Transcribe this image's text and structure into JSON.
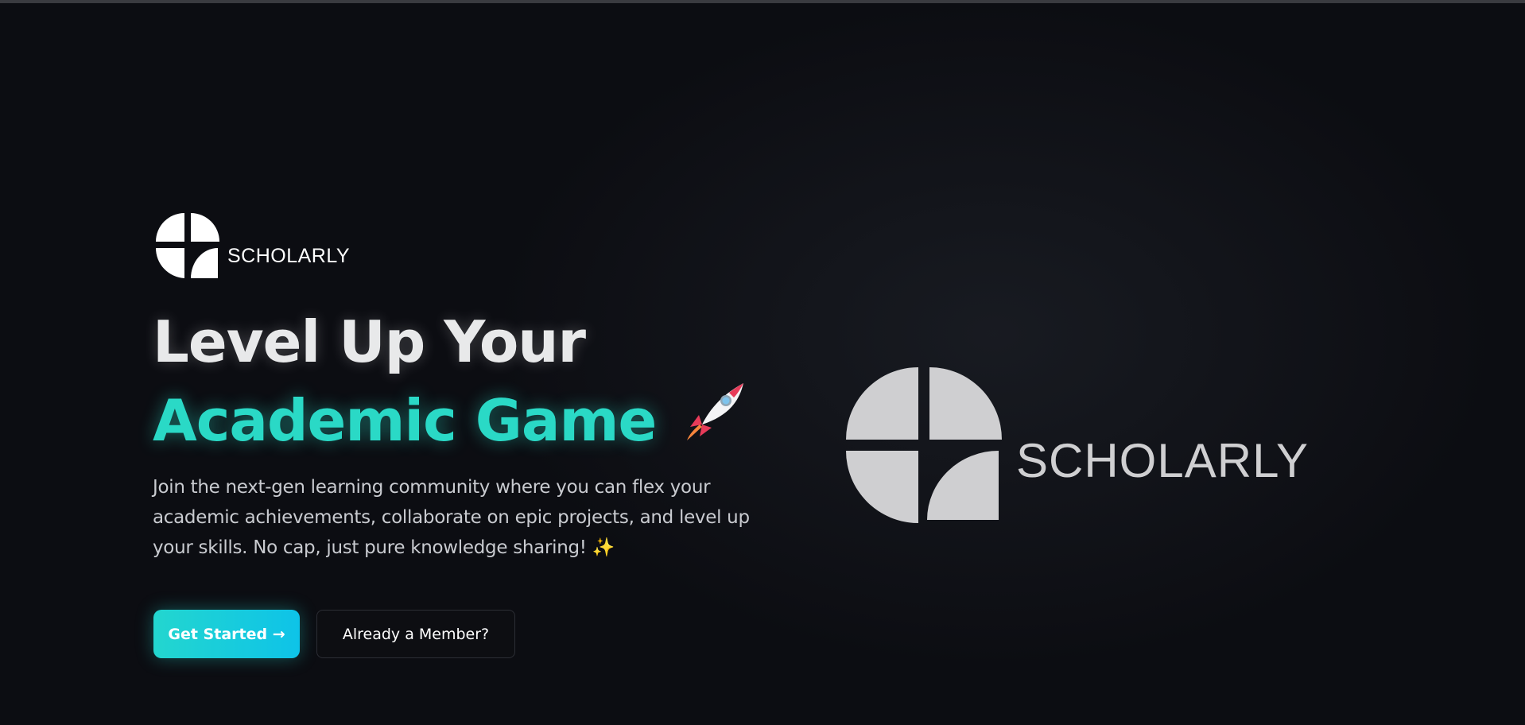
{
  "brand": {
    "name": "SCHOLARLY",
    "logo_icon": "scholarly-logo-icon",
    "logo_color_small": "#ffffff",
    "logo_color_large": "#cfcfd1"
  },
  "hero": {
    "headline_line1": "Level Up Your",
    "headline_line2": "Academic Game",
    "headline_emoji": "🚀",
    "description": "Join the next-gen learning community where you can flex your academic achievements, collaborate on epic projects, and level up your skills. No cap, just pure knowledge sharing!",
    "description_emoji": "✨",
    "accent_color": "#2ad9c6"
  },
  "actions": {
    "primary_label": "Get Started →",
    "secondary_label": "Already a Member?"
  }
}
